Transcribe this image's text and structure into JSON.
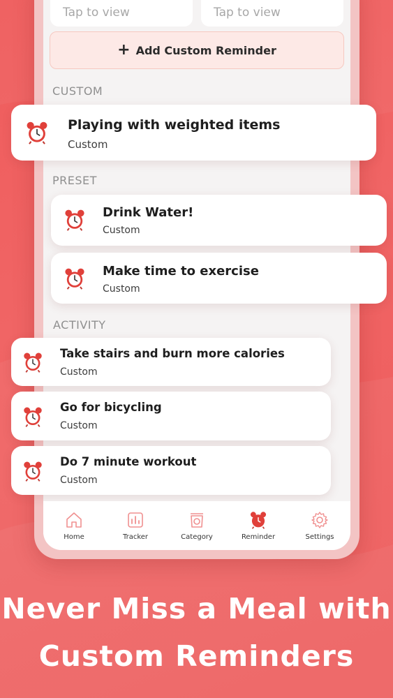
{
  "top_cards": [
    {
      "tap_label": "Tap to view"
    },
    {
      "tap_label": "Tap to view"
    }
  ],
  "add_button": {
    "icon": "plus-icon",
    "label": "Add Custom Reminder"
  },
  "sections": {
    "custom": "CUSTOM",
    "preset": "PRESET",
    "activity": "ACTIVITY"
  },
  "reminders": [
    {
      "title": "Playing with weighted items",
      "sub": "Custom",
      "icon": "alarm-clock-icon"
    },
    {
      "title": "Drink Water!",
      "sub": "Custom",
      "icon": "alarm-clock-icon"
    },
    {
      "title": "Make time to exercise",
      "sub": "Custom",
      "icon": "alarm-clock-icon"
    },
    {
      "title": "Take stairs and burn more calories",
      "sub": "Custom",
      "icon": "alarm-clock-icon"
    },
    {
      "title": "Go for bicycling",
      "sub": "Custom",
      "icon": "alarm-clock-icon"
    },
    {
      "title": "Do 7 minute workout",
      "sub": "Custom",
      "icon": "alarm-clock-icon"
    }
  ],
  "nav": [
    {
      "label": "Home",
      "icon": "home-icon",
      "active": false
    },
    {
      "label": "Tracker",
      "icon": "tracker-icon",
      "active": false
    },
    {
      "label": "Category",
      "icon": "category-icon",
      "active": false
    },
    {
      "label": "Reminder",
      "icon": "alarm-clock-icon",
      "active": true
    },
    {
      "label": "Settings",
      "icon": "gear-icon",
      "active": false
    }
  ],
  "headline": {
    "line1": "Never Miss a Meal with",
    "line2": "Custom Reminders"
  },
  "colors": {
    "accent": "#ef4b4b",
    "background": "#ef5c5c",
    "nav_icon": "#f09090"
  }
}
